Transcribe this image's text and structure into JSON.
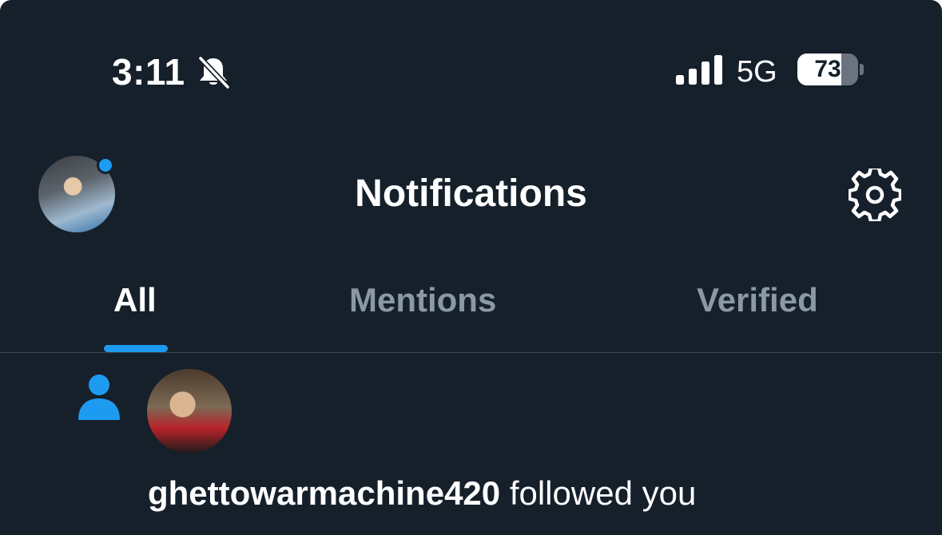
{
  "status_bar": {
    "time": "3:11",
    "network": "5G",
    "battery_level": "73",
    "battery_fraction": 0.73,
    "icons": [
      "bell-slash-icon",
      "cellular-signal-icon",
      "battery-icon"
    ]
  },
  "header": {
    "title": "Notifications",
    "has_new_indicator": true,
    "icons": [
      "settings-gear-icon"
    ]
  },
  "tabs": [
    {
      "label": "All",
      "active": true
    },
    {
      "label": "Mentions",
      "active": false
    },
    {
      "label": "Verified",
      "active": false
    }
  ],
  "notifications": [
    {
      "type_icon": "person-icon",
      "username": "ghettowarmachine420",
      "action": "followed you"
    }
  ],
  "colors": {
    "background": "#15202b",
    "accent": "#1d9bf0",
    "muted_text": "#8b98a5",
    "divider": "#38444d"
  }
}
